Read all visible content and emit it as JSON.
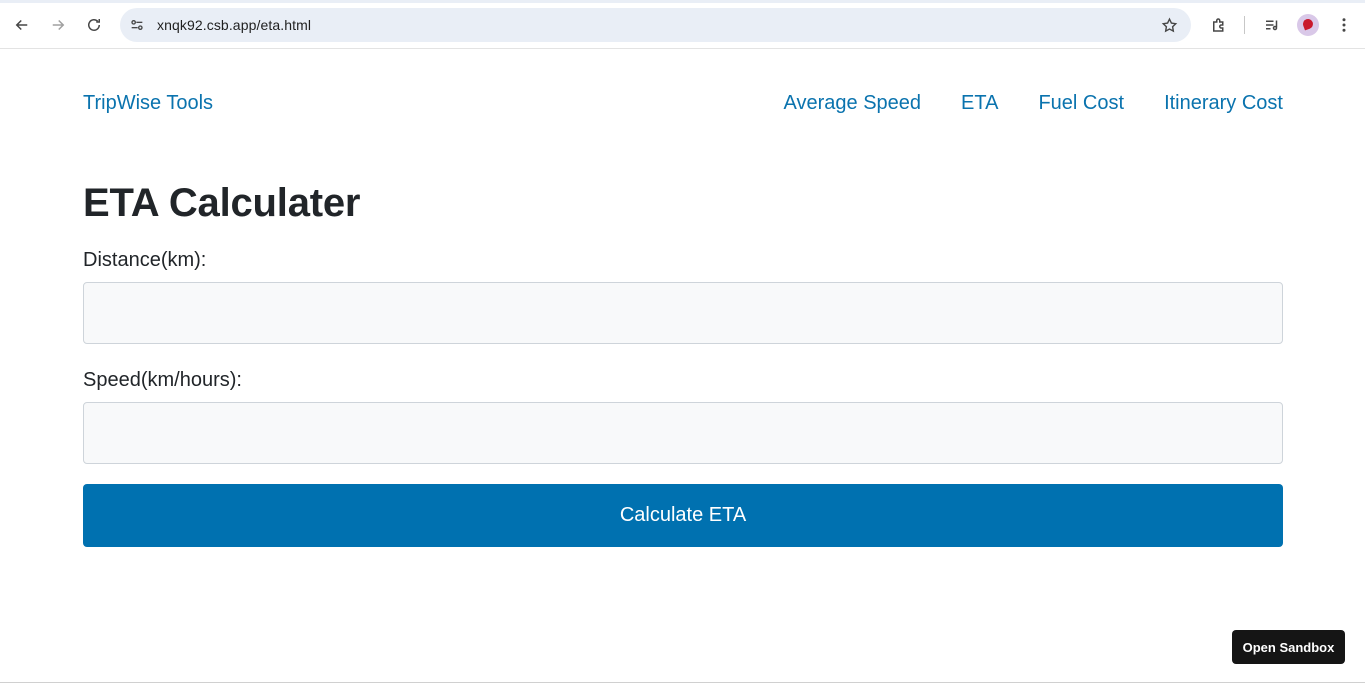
{
  "browser": {
    "url": "xnqk92.csb.app/eta.html"
  },
  "nav": {
    "brand": "TripWise Tools",
    "links": [
      "Average Speed",
      "ETA",
      "Fuel Cost",
      "Itinerary Cost"
    ]
  },
  "form": {
    "title": "ETA Calculater",
    "distance_label": "Distance(km):",
    "distance_value": "",
    "speed_label": "Speed(km/hours):",
    "speed_value": "",
    "submit_label": "Calculate ETA"
  },
  "sandbox": {
    "label": "Open Sandbox"
  },
  "colors": {
    "link": "#0a73ae",
    "button": "#0071b0",
    "heading": "#212529"
  }
}
